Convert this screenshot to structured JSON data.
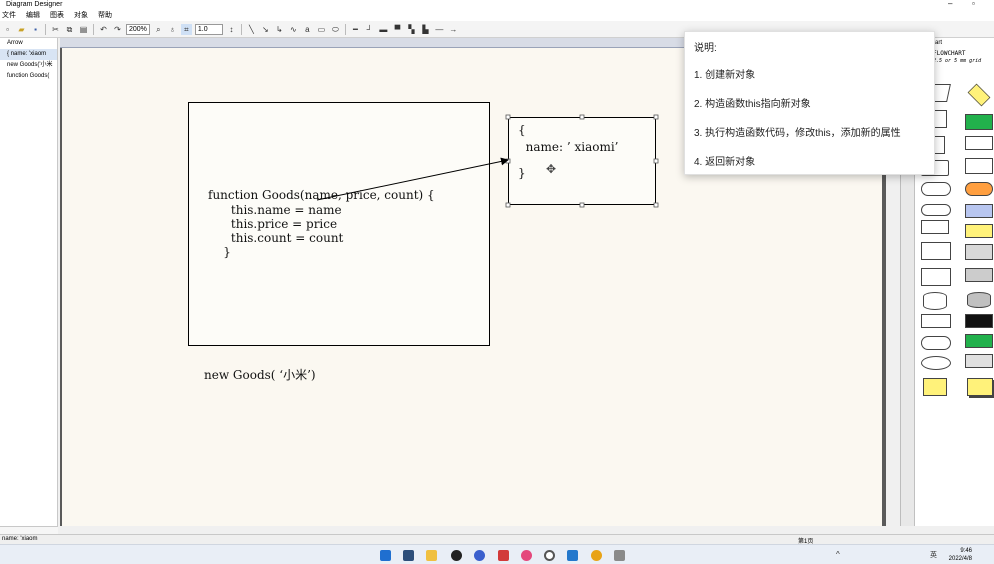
{
  "window": {
    "title": "Diagram Designer",
    "controls": [
      "–",
      "▫"
    ]
  },
  "menu": [
    "文件",
    "编辑",
    "图表",
    "对象",
    "帮助"
  ],
  "toolbar": {
    "zoom": "200%",
    "line_width": "1.0"
  },
  "tree": {
    "items": [
      {
        "label": "Arrow",
        "selected": false
      },
      {
        "label": "{ name: 'xiaom",
        "selected": true
      },
      {
        "label": "new Goods('小米",
        "selected": false
      },
      {
        "label": "function Goods(",
        "selected": false
      }
    ]
  },
  "canvas": {
    "function_box": {
      "lines": [
        "function Goods(name, price, count) {",
        "      this.name = name",
        "      this.price = price",
        "      this.count = count",
        "    }"
      ]
    },
    "object_box": {
      "lines": [
        "{",
        "  name: ’ xiaomi’",
        "}"
      ]
    },
    "new_call": "new Goods( ‘小米’)"
  },
  "palette": {
    "title": "FLOWCHART",
    "subtitle": "2.5 or 5 mm grid",
    "header_fragment": "art"
  },
  "tooltip": {
    "title": "说明:",
    "steps": [
      "1. 创建新对象",
      "2. 构造函数this指向新对象",
      "3. 执行构造函数代码，修改this，添加新的属性",
      "4. 返回新对象"
    ]
  },
  "statusbar": {
    "left": "name: 'xiaom",
    "page": "第1页"
  },
  "taskbar": {
    "time": "9:46",
    "date": "2022/4/8",
    "lang": "英"
  },
  "colors": {
    "accent": "#3b78d8",
    "canvas": "#fbf8f1",
    "green_shape": "#22b14c",
    "yellow_shape": "#fff27a",
    "orange_shape": "#ff9f40"
  }
}
